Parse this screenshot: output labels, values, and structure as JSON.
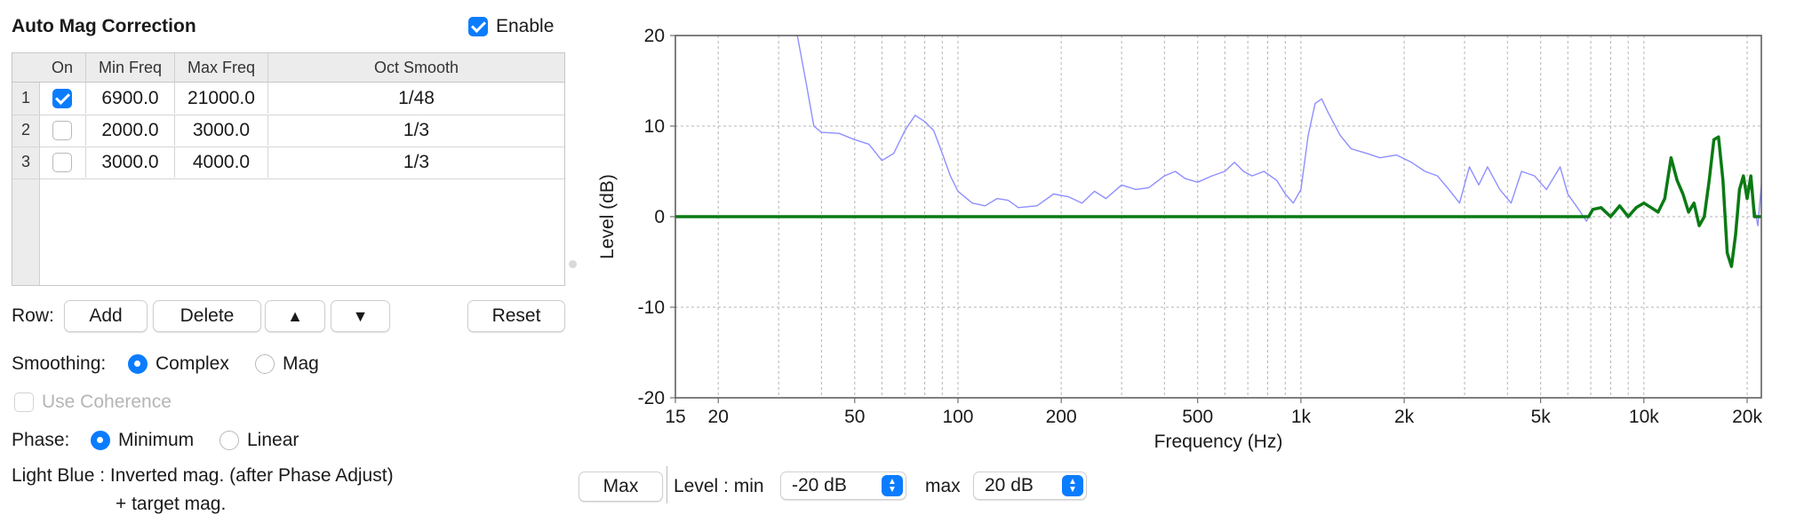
{
  "panel": {
    "title": "Auto Mag Correction",
    "enable_label": "Enable",
    "enable_checked": true
  },
  "table": {
    "headers": [
      "On",
      "Min Freq",
      "Max Freq",
      "Oct Smooth"
    ],
    "rows": [
      {
        "index": "1",
        "on": true,
        "min": "6900.0",
        "max": "21000.0",
        "smooth": "1/48"
      },
      {
        "index": "2",
        "on": false,
        "min": "2000.0",
        "max": "3000.0",
        "smooth": "1/3"
      },
      {
        "index": "3",
        "on": false,
        "min": "3000.0",
        "max": "4000.0",
        "smooth": "1/3"
      }
    ]
  },
  "row_controls": {
    "label": "Row:",
    "add": "Add",
    "delete": "Delete",
    "up": "▲",
    "down": "▼",
    "reset": "Reset"
  },
  "smoothing": {
    "label": "Smoothing:",
    "options": [
      "Complex",
      "Mag"
    ],
    "selected": "Complex"
  },
  "coherence": {
    "label": "Use Coherence",
    "checked": false,
    "enabled": false
  },
  "phase": {
    "label": "Phase:",
    "options": [
      "Minimum",
      "Linear"
    ],
    "selected": "Minimum"
  },
  "legend_note": {
    "line1": "Light Blue : Inverted mag. (after Phase Adjust)",
    "line2": "+ target mag."
  },
  "bottom": {
    "max_button": "Max",
    "level_min_label": "Level : min",
    "level_min_value": "-20 dB",
    "max_label": "max",
    "level_max_value": "20 dB"
  },
  "colors": {
    "accent": "#0a7cff",
    "inverted_mag": "#8f8fff",
    "target_mag": "#0a7a14"
  },
  "chart_data": {
    "type": "line",
    "xlabel": "Frequency (Hz)",
    "ylabel": "Level (dB)",
    "x_scale": "log",
    "xlim": [
      15,
      22000
    ],
    "ylim": [
      -20,
      20
    ],
    "y_ticks": [
      20,
      10,
      0,
      -10,
      -20
    ],
    "x_tick_labels": [
      {
        "v": 15,
        "t": "15"
      },
      {
        "v": 20,
        "t": "20"
      },
      {
        "v": 50,
        "t": "50"
      },
      {
        "v": 100,
        "t": "100"
      },
      {
        "v": 200,
        "t": "200"
      },
      {
        "v": 500,
        "t": "500"
      },
      {
        "v": 1000,
        "t": "1k"
      },
      {
        "v": 2000,
        "t": "2k"
      },
      {
        "v": 5000,
        "t": "5k"
      },
      {
        "v": 10000,
        "t": "10k"
      },
      {
        "v": 20000,
        "t": "20k"
      }
    ],
    "grid": true,
    "series": [
      {
        "color": "#8f8fff",
        "points": [
          [
            34,
            20
          ],
          [
            36,
            15
          ],
          [
            38,
            10
          ],
          [
            40,
            9.3
          ],
          [
            45,
            9.2
          ],
          [
            50,
            8.5
          ],
          [
            55,
            8
          ],
          [
            60,
            6.2
          ],
          [
            65,
            7
          ],
          [
            70,
            9.5
          ],
          [
            75,
            11.2
          ],
          [
            80,
            10.5
          ],
          [
            85,
            9.5
          ],
          [
            90,
            7
          ],
          [
            95,
            4.5
          ],
          [
            100,
            2.8
          ],
          [
            110,
            1.5
          ],
          [
            120,
            1.2
          ],
          [
            130,
            2
          ],
          [
            140,
            1.8
          ],
          [
            150,
            1
          ],
          [
            170,
            1.2
          ],
          [
            190,
            2.5
          ],
          [
            210,
            2.2
          ],
          [
            230,
            1.5
          ],
          [
            250,
            2.8
          ],
          [
            270,
            2
          ],
          [
            300,
            3.5
          ],
          [
            330,
            3
          ],
          [
            360,
            3.2
          ],
          [
            400,
            4.5
          ],
          [
            430,
            5
          ],
          [
            460,
            4.2
          ],
          [
            500,
            3.8
          ],
          [
            550,
            4.5
          ],
          [
            600,
            5
          ],
          [
            640,
            6
          ],
          [
            680,
            5
          ],
          [
            720,
            4.5
          ],
          [
            780,
            5
          ],
          [
            850,
            4
          ],
          [
            900,
            2.5
          ],
          [
            950,
            1.5
          ],
          [
            1000,
            3
          ],
          [
            1050,
            9
          ],
          [
            1100,
            12.5
          ],
          [
            1150,
            13
          ],
          [
            1200,
            11.5
          ],
          [
            1300,
            9
          ],
          [
            1400,
            7.5
          ],
          [
            1550,
            7
          ],
          [
            1700,
            6.5
          ],
          [
            1900,
            6.8
          ],
          [
            2100,
            6
          ],
          [
            2300,
            5
          ],
          [
            2500,
            4.5
          ],
          [
            2700,
            3
          ],
          [
            2900,
            1.5
          ],
          [
            3100,
            5.5
          ],
          [
            3300,
            3.5
          ],
          [
            3500,
            5.5
          ],
          [
            3800,
            3
          ],
          [
            4100,
            1.5
          ],
          [
            4400,
            5
          ],
          [
            4800,
            4.5
          ],
          [
            5200,
            3
          ],
          [
            5700,
            5.5
          ],
          [
            6000,
            2.5
          ],
          [
            6400,
            1
          ],
          [
            6800,
            -0.5
          ],
          [
            7100,
            0.8
          ],
          [
            7500,
            1
          ],
          [
            8000,
            0
          ],
          [
            8500,
            1.2
          ],
          [
            9000,
            0
          ],
          [
            9500,
            1
          ],
          [
            10000,
            1.5
          ],
          [
            10500,
            1
          ],
          [
            11000,
            0.5
          ],
          [
            11500,
            2
          ],
          [
            12000,
            6.5
          ],
          [
            12500,
            4
          ],
          [
            13000,
            2.5
          ],
          [
            13500,
            0.5
          ],
          [
            14000,
            1.5
          ],
          [
            14500,
            -1
          ],
          [
            15000,
            0
          ],
          [
            15500,
            4
          ],
          [
            16000,
            8.5
          ],
          [
            16500,
            8.8
          ],
          [
            17000,
            4
          ],
          [
            17500,
            -4
          ],
          [
            18000,
            -5.5
          ],
          [
            18500,
            -2
          ],
          [
            19000,
            3
          ],
          [
            19500,
            4.5
          ],
          [
            20000,
            2
          ],
          [
            20500,
            4.5
          ],
          [
            21000,
            1
          ],
          [
            21500,
            -1
          ],
          [
            22000,
            3.5
          ]
        ]
      },
      {
        "color": "#0a7a14",
        "points": [
          [
            15,
            0
          ],
          [
            6900,
            0
          ],
          [
            7100,
            0.8
          ],
          [
            7500,
            1
          ],
          [
            8000,
            0
          ],
          [
            8500,
            1.2
          ],
          [
            9000,
            0
          ],
          [
            9500,
            1
          ],
          [
            10000,
            1.5
          ],
          [
            10500,
            1
          ],
          [
            11000,
            0.5
          ],
          [
            11500,
            2
          ],
          [
            12000,
            6.5
          ],
          [
            12500,
            4
          ],
          [
            13000,
            2.5
          ],
          [
            13500,
            0.5
          ],
          [
            14000,
            1.5
          ],
          [
            14500,
            -1
          ],
          [
            15000,
            0
          ],
          [
            15500,
            4
          ],
          [
            16000,
            8.5
          ],
          [
            16500,
            8.8
          ],
          [
            17000,
            4
          ],
          [
            17500,
            -4
          ],
          [
            18000,
            -5.5
          ],
          [
            18500,
            -2
          ],
          [
            19000,
            3
          ],
          [
            19500,
            4.5
          ],
          [
            20000,
            2
          ],
          [
            20500,
            4.5
          ],
          [
            21000,
            0
          ],
          [
            22000,
            0
          ]
        ]
      }
    ]
  }
}
